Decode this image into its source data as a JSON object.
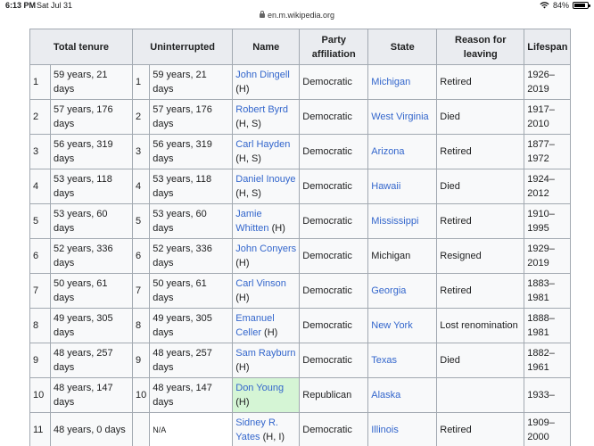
{
  "status_bar": {
    "time": "6:13 PM",
    "date": "Sat Jul 31",
    "battery": "84%",
    "battery_level": 0.84
  },
  "browser": {
    "url": "en.m.wikipedia.org"
  },
  "table": {
    "headers": [
      "Total tenure",
      "Uninterrupted",
      "Name",
      "Party affiliation",
      "State",
      "Reason for leaving",
      "Lifespan"
    ],
    "rows": [
      {
        "rank": "1",
        "total": "59 years, 21 days",
        "urank": "1",
        "unint": "59 years, 21 days",
        "name": "John Dingell",
        "chamber": "(H)",
        "party": "Democratic",
        "state": "Michigan",
        "state_link": true,
        "reason": "Retired",
        "lifespan": "1926–2019"
      },
      {
        "rank": "2",
        "total": "57 years, 176 days",
        "urank": "2",
        "unint": "57 years, 176 days",
        "name": "Robert Byrd",
        "chamber": "(H, S)",
        "party": "Democratic",
        "state": "West Virginia",
        "state_link": true,
        "reason": "Died",
        "lifespan": "1917–2010"
      },
      {
        "rank": "3",
        "total": "56 years, 319 days",
        "urank": "3",
        "unint": "56 years, 319 days",
        "name": "Carl Hayden",
        "chamber": "(H, S)",
        "party": "Democratic",
        "state": "Arizona",
        "state_link": true,
        "reason": "Retired",
        "lifespan": "1877–1972"
      },
      {
        "rank": "4",
        "total": "53 years, 118 days",
        "urank": "4",
        "unint": "53 years, 118 days",
        "name": "Daniel Inouye",
        "chamber": "(H, S)",
        "party": "Democratic",
        "state": "Hawaii",
        "state_link": true,
        "reason": "Died",
        "lifespan": "1924–2012"
      },
      {
        "rank": "5",
        "total": "53 years, 60 days",
        "urank": "5",
        "unint": "53 years, 60 days",
        "name": "Jamie Whitten",
        "chamber": "(H)",
        "party": "Democratic",
        "state": "Mississippi",
        "state_link": true,
        "reason": "Retired",
        "lifespan": "1910–1995"
      },
      {
        "rank": "6",
        "total": "52 years, 336 days",
        "urank": "6",
        "unint": "52 years, 336 days",
        "name": "John Conyers",
        "chamber": "(H)",
        "party": "Democratic",
        "state": "Michigan",
        "state_link": false,
        "reason": "Resigned",
        "lifespan": "1929–2019"
      },
      {
        "rank": "7",
        "total": "50 years, 61 days",
        "urank": "7",
        "unint": "50 years, 61 days",
        "name": "Carl Vinson",
        "chamber": "(H)",
        "party": "Democratic",
        "state": "Georgia",
        "state_link": true,
        "reason": "Retired",
        "lifespan": "1883–1981"
      },
      {
        "rank": "8",
        "total": "49 years, 305 days",
        "urank": "8",
        "unint": "49 years, 305 days",
        "name": "Emanuel Celler",
        "chamber": "(H)",
        "party": "Democratic",
        "state": "New York",
        "state_link": true,
        "reason": "Lost renomination",
        "lifespan": "1888–1981"
      },
      {
        "rank": "9",
        "total": "48 years, 257 days",
        "urank": "9",
        "unint": "48 years, 257 days",
        "name": "Sam Rayburn",
        "chamber": "(H)",
        "party": "Democratic",
        "state": "Texas",
        "state_link": true,
        "reason": "Died",
        "lifespan": "1882–1961"
      },
      {
        "rank": "10",
        "total": "48 years, 147 days",
        "urank": "10",
        "unint": "48 years, 147 days",
        "name": "Don Young",
        "chamber": "(H)",
        "party": "Republican",
        "state": "Alaska",
        "state_link": true,
        "reason": "",
        "lifespan": "1933–",
        "highlight": true
      },
      {
        "rank": "11",
        "total": "48 years, 0 days",
        "urank": "",
        "unint": "N/A",
        "name": "Sidney R. Yates",
        "chamber": "(H, I)",
        "party": "Democratic",
        "state": "Illinois",
        "state_link": true,
        "reason": "Retired",
        "lifespan": "1909–2000"
      }
    ]
  },
  "colors": {
    "link": "#3366cc",
    "header_bg": "#eaecf0",
    "border": "#a2a9b1",
    "highlight": "#d5f5d5"
  }
}
